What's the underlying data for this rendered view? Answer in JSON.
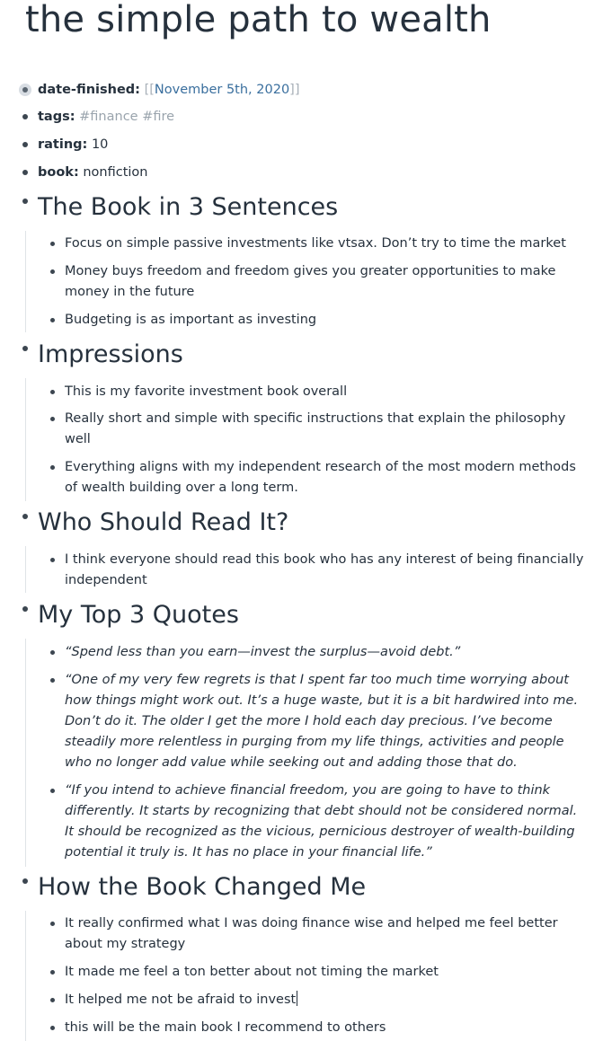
{
  "page": {
    "title": "the simple path to wealth"
  },
  "properties": {
    "date_finished": {
      "key": "date-finished:",
      "open": "[[",
      "value": "November 5th, 2020",
      "close": "]]"
    },
    "tags": {
      "key": "tags:",
      "values": [
        "#finance",
        "#fire"
      ]
    },
    "rating": {
      "key": "rating:",
      "value": "10"
    },
    "book": {
      "key": "book:",
      "value": "nonfiction"
    }
  },
  "sections": [
    {
      "heading": "The Book in 3 Sentences",
      "items": [
        "Focus on simple passive investments like vtsax. Don’t try to time the market",
        "Money buys freedom and freedom gives you greater opportunities to make money in the future",
        "Budgeting is as important as investing"
      ]
    },
    {
      "heading": "Impressions",
      "items": [
        "This is my favorite investment book overall",
        "Really short and simple with specific instructions that explain the philosophy well",
        "Everything aligns with my independent research of the most modern methods of wealth building over a long term."
      ]
    },
    {
      "heading": "Who Should Read It?",
      "items": [
        "I think everyone should read this book who has any interest of being financially independent"
      ]
    },
    {
      "heading": "My Top 3 Quotes",
      "items": [
        "“Spend less than you earn—invest the surplus—avoid debt.”",
        "“One of my very few regrets is that I spent far too much time worrying about how things might work out. It’s a huge waste, but it is a bit hardwired into me. Don’t do it. The older I get the more I hold each day precious. I’ve become steadily more relentless in purging from my life things, activities and people who no longer add value while seeking out and adding those that do.",
        "“If you intend to achieve financial freedom, you are going to have to think differently. It starts by recognizing that debt should not be considered normal. It should be recognized as the vicious, pernicious destroyer of wealth-building potential it truly is. It has no place in your financial life.”"
      ]
    },
    {
      "heading": " How the Book Changed Me",
      "items": [
        "It really confirmed what I was doing finance wise and helped me feel better about my strategy",
        "It made me feel a ton better about not timing the market",
        "It helped me not be afraid to invest",
        "this will be the main book I recommend to others"
      ]
    }
  ]
}
